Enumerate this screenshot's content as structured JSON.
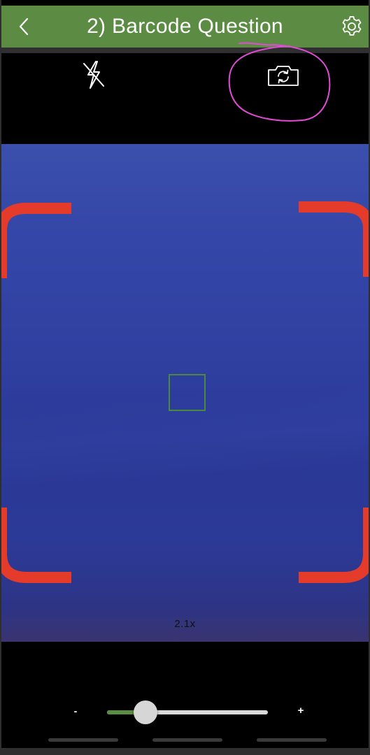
{
  "header": {
    "title": "2) Barcode Question",
    "back_icon": "chevron-left-icon",
    "settings_icon": "gear-icon",
    "background_color": "#5c8b43"
  },
  "camera_toolbar": {
    "flash_icon": "flash-off-icon",
    "switch_camera_icon": "camera-switch-icon",
    "annotation_color": "#e24ad8"
  },
  "viewfinder": {
    "zoom_readout": "2.1x",
    "corner_color": "#e53b2a",
    "focus_box_color": "#4a8a3a"
  },
  "zoom_slider": {
    "minus_label": "-",
    "plus_label": "+",
    "value_fraction": 0.24,
    "fill_color": "#5c8b43"
  }
}
